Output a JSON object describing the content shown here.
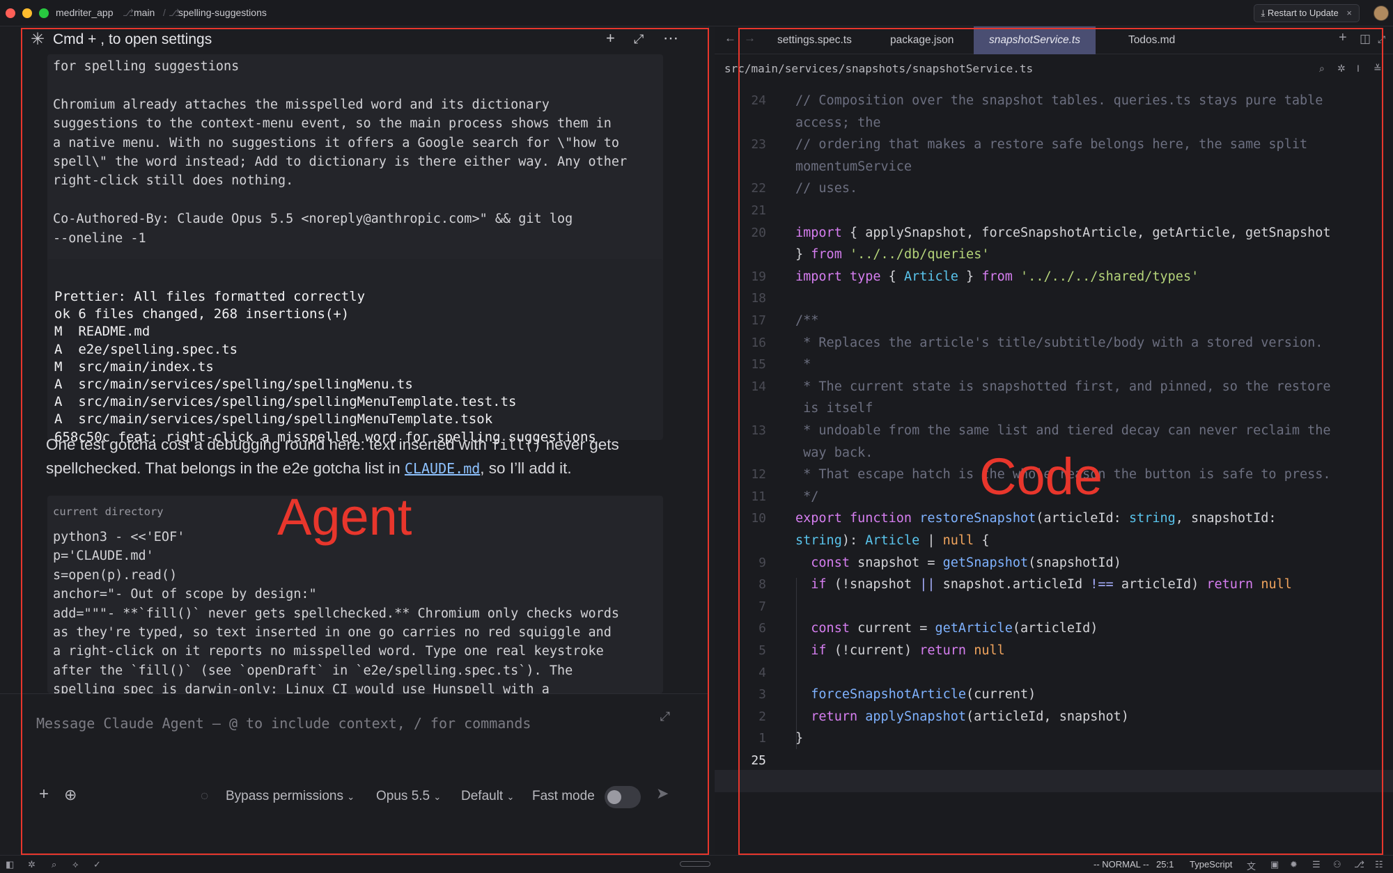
{
  "titlebar": {
    "project": "medriter_app",
    "branch": "main",
    "worktree": "spelling-suggestions",
    "restart_label": "Restart to Update",
    "close_glyph": "×"
  },
  "agent": {
    "header_title": "Cmd + , to open settings",
    "header_icon": "sparkle-icon",
    "commit_message_lines": [
      "for spelling suggestions",
      "",
      "Chromium already attaches the misspelled word and its dictionary",
      "suggestions to the context-menu event, so the main process shows them in",
      "a native menu. With no suggestions it offers a Google search for \\\"how to",
      "spell\\\" the word instead; Add to dictionary is there either way. Any other",
      "right-click still does nothing.",
      "",
      "Co-Authored-By: Claude Opus 5.5 <noreply@anthropic.com>\" && git log",
      "--oneline -1"
    ],
    "output_lines": [
      "Prettier: All files formatted correctly",
      "ok 6 files changed, 268 insertions(+)",
      "M  README.md",
      "A  e2e/spelling.spec.ts",
      "M  src/main/index.ts",
      "A  src/main/services/spelling/spellingMenu.ts",
      "A  src/main/services/spelling/spellingMenuTemplate.test.ts",
      "A  src/main/services/spelling/spellingMenuTemplate.tsok",
      "658c50c feat: right-click a misspelled word for spelling suggestions"
    ],
    "prose": {
      "part1": "One test gotcha cost a debugging round here: text inserted with ",
      "code1": "fill()",
      "part2": " never gets spellchecked. That belongs in the e2e gotcha list in ",
      "link": "CLAUDE.md",
      "part3": ", so I’ll add it."
    },
    "cwd_label": "current directory",
    "script_lines": [
      "python3 - <<'EOF'",
      "p='CLAUDE.md'",
      "s=open(p).read()",
      "anchor=\"- Out of scope by design:\"",
      "add=\"\"\"- **`fill()` never gets spellchecked.** Chromium only checks words",
      "as they're typed, so text inserted in one go carries no red squiggle and",
      "a right-click on it reports no misspelled word. Type one real keystroke",
      "after the `fill()` (see `openDraft` in `e2e/spelling.spec.ts`). The",
      "spelling spec is darwin-only: Linux CI would use Hunspell with a"
    ],
    "annotation": "Agent",
    "input_placeholder": "Message Claude Agent — @ to include context, / for commands",
    "controls": {
      "permissions": "Bypass permissions",
      "model": "Opus 5.5",
      "mode": "Default",
      "fast_mode": "Fast mode",
      "fast_mode_on": false
    }
  },
  "editor": {
    "tabs": [
      "settings.spec.ts",
      "package.json",
      "snapshotService.ts",
      "Todos.md"
    ],
    "active_tab": 2,
    "path": "src/main/services/snapshots/snapshotService.ts",
    "annotation": "Code",
    "line_numbers": [
      "24",
      "",
      "23",
      "",
      "22",
      "21",
      "20",
      "",
      "19",
      "18",
      "17",
      "16",
      "15",
      "14",
      "",
      "13",
      "",
      "12",
      "11",
      "10",
      "",
      "9",
      "8",
      "7",
      "6",
      "5",
      "4",
      "3",
      "2",
      "1",
      "25"
    ],
    "lines": [
      [
        [
          "c",
          "// Composition over the snapshot tables. queries.ts stays pure table"
        ]
      ],
      [
        [
          "c",
          "access; the"
        ]
      ],
      [
        [
          "c",
          "// ordering that makes a restore safe belongs here, the same split"
        ]
      ],
      [
        [
          "c",
          "momentumService"
        ]
      ],
      [
        [
          "c",
          "// uses."
        ]
      ],
      [],
      [
        [
          "k",
          "import"
        ],
        [
          "p",
          " { applySnapshot, forceSnapshotArticle, getArticle, getSnapshot"
        ]
      ],
      [
        [
          "p",
          "} "
        ],
        [
          "k",
          "from"
        ],
        [
          "p",
          " "
        ],
        [
          "s",
          "'../../db/queries'"
        ]
      ],
      [
        [
          "k",
          "import type"
        ],
        [
          "p",
          " { "
        ],
        [
          "t",
          "Article"
        ],
        [
          "p",
          " } "
        ],
        [
          "k",
          "from"
        ],
        [
          "p",
          " "
        ],
        [
          "s",
          "'../../../shared/types'"
        ]
      ],
      [],
      [
        [
          "c",
          "/**"
        ]
      ],
      [
        [
          "c",
          " * Replaces the article's title/subtitle/body with a stored version."
        ]
      ],
      [
        [
          "c",
          " *"
        ]
      ],
      [
        [
          "c",
          " * The current state is snapshotted first, and pinned, so the restore"
        ]
      ],
      [
        [
          "c",
          " is itself"
        ]
      ],
      [
        [
          "c",
          " * undoable from the same list and tiered decay can never reclaim the"
        ]
      ],
      [
        [
          "c",
          " way back."
        ]
      ],
      [
        [
          "c",
          " * That escape hatch is the whole reason the button is safe to press."
        ]
      ],
      [
        [
          "c",
          " */"
        ]
      ],
      [
        [
          "k",
          "export function"
        ],
        [
          "p",
          " "
        ],
        [
          "f",
          "restoreSnapshot"
        ],
        [
          "p",
          "(articleId: "
        ],
        [
          "t",
          "string"
        ],
        [
          "p",
          ", snapshotId:"
        ]
      ],
      [
        [
          "t",
          "string"
        ],
        [
          "p",
          "): "
        ],
        [
          "t",
          "Article"
        ],
        [
          "p",
          " | "
        ],
        [
          "n",
          "null"
        ],
        [
          "p",
          " {"
        ]
      ],
      [
        [
          "p",
          "  "
        ],
        [
          "k",
          "const"
        ],
        [
          "p",
          " snapshot = "
        ],
        [
          "f",
          "getSnapshot"
        ],
        [
          "p",
          "(snapshotId)"
        ]
      ],
      [
        [
          "p",
          "  "
        ],
        [
          "k",
          "if"
        ],
        [
          "p",
          " (!snapshot "
        ],
        [
          "o",
          "||"
        ],
        [
          "p",
          " snapshot.articleId "
        ],
        [
          "o",
          "!=="
        ],
        [
          "p",
          " articleId) "
        ],
        [
          "k",
          "return"
        ],
        [
          "p",
          " "
        ],
        [
          "n",
          "null"
        ]
      ],
      [],
      [
        [
          "p",
          "  "
        ],
        [
          "k",
          "const"
        ],
        [
          "p",
          " current = "
        ],
        [
          "f",
          "getArticle"
        ],
        [
          "p",
          "(articleId)"
        ]
      ],
      [
        [
          "p",
          "  "
        ],
        [
          "k",
          "if"
        ],
        [
          "p",
          " (!current) "
        ],
        [
          "k",
          "return"
        ],
        [
          "p",
          " "
        ],
        [
          "n",
          "null"
        ]
      ],
      [],
      [
        [
          "p",
          "  "
        ],
        [
          "f",
          "forceSnapshotArticle"
        ],
        [
          "p",
          "(current)"
        ]
      ],
      [
        [
          "p",
          "  "
        ],
        [
          "k",
          "return"
        ],
        [
          "p",
          " "
        ],
        [
          "f",
          "applySnapshot"
        ],
        [
          "p",
          "(articleId, snapshot)"
        ]
      ],
      [
        [
          "p",
          "}"
        ]
      ],
      []
    ]
  },
  "statusbar": {
    "mode": "-- NORMAL --",
    "position": "25:1",
    "language": "TypeScript"
  },
  "colors": {
    "highlight": "#e8362c",
    "active_tab": "#4a4e72",
    "keyword": "#d67ef0",
    "string": "#b5d47a",
    "type": "#59c4ec",
    "function": "#7fb2ff",
    "comment": "#6c6f80",
    "null": "#f0a45d"
  }
}
